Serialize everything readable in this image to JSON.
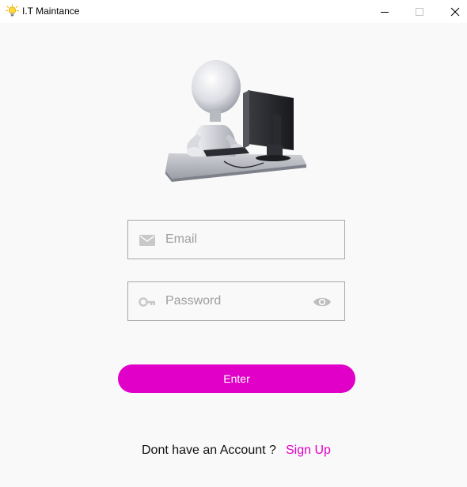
{
  "window": {
    "title": "I.T Maintance",
    "icon": "lightbulb-icon"
  },
  "window_controls": {
    "minimize": "minimize-icon",
    "maximize": "maximize-icon",
    "close": "close-icon"
  },
  "illustration": {
    "icon": "stick-figure-at-computer"
  },
  "form": {
    "email": {
      "placeholder": "Email",
      "value": "",
      "icon": "mail-icon"
    },
    "password": {
      "placeholder": "Password",
      "value": "",
      "icon": "key-icon",
      "toggle_icon": "eye-icon"
    },
    "enter_label": "Enter"
  },
  "footer": {
    "prompt": "Dont have an Account ?",
    "link": "Sign Up"
  },
  "colors": {
    "accent": "#e100c7",
    "background": "#f9f9f9",
    "border": "#a7a7a7",
    "icon_grey": "#c8c8c8"
  }
}
